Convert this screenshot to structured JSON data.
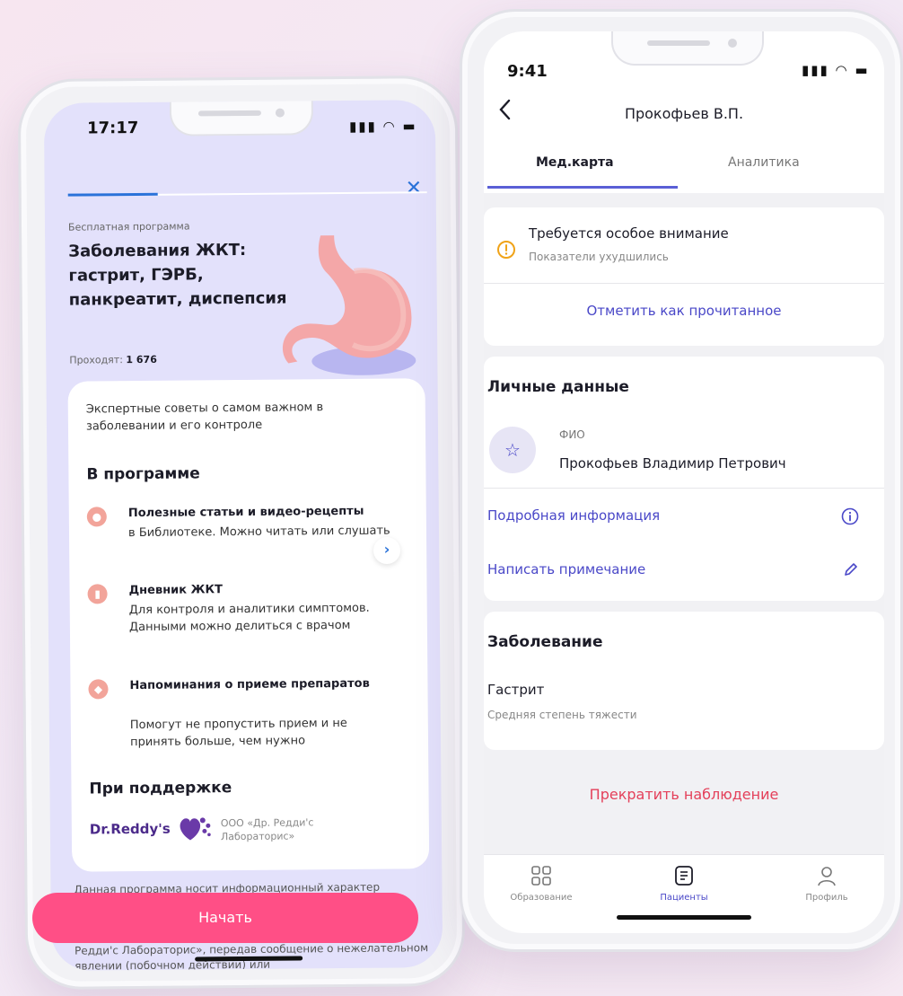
{
  "left_phone": {
    "status_time": "17:17",
    "program_type": "Бесплатная программа",
    "program_title": "Заболевания ЖКТ: гастрит, ГЭРБ, панкреатит, диспепсия",
    "participants_label": "Проходят:",
    "participants_count": "1 676",
    "progress": 0.25,
    "intro": "Экспертные советы о самом важном в заболевании и его контроле",
    "in_program_heading": "В программе",
    "features": [
      {
        "title": "Полезные статьи и видео-рецепты",
        "desc": "в Библиотеке. Можно читать или слушать",
        "icon": "article-icon"
      },
      {
        "title": "Дневник ЖКТ",
        "desc": "Для контроля и аналитики симптомов. Данными можно делиться с врачом",
        "icon": "diary-icon"
      },
      {
        "title": "Напоминания о приеме препаратов",
        "desc": "Помогут не пропустить прием и не принять больше, чем нужно",
        "icon": "pill-icon"
      }
    ],
    "support_heading": "При поддержке",
    "sponsor_logo_text": "Dr.Reddy's",
    "sponsor_name": "ООО «Др. Редди'с Лабораторис»",
    "disclaimer_top": "Данная программа носит информационный характер",
    "disclaimer_bottom": "Редди'с Лабораторис», передав сообщение о нежелательном явлении (побочном действии) или",
    "start_button": "Начать",
    "accent_color": "#ff4f86"
  },
  "right_phone": {
    "status_time": "9:41",
    "patient_title": "Прокофьев В.П.",
    "tabs": [
      {
        "label": "Мед.карта",
        "active": true
      },
      {
        "label": "Аналитика",
        "active": false
      }
    ],
    "alert_title": "Требуется особое внимание",
    "alert_subtitle": "Показатели ухудшились",
    "mark_read_button": "Отметить как прочитанное",
    "personal_heading": "Личные данные",
    "fio_label": "ФИО",
    "fio_value": "Прокофьев Владимир Петрович",
    "details_link": "Подробная информация",
    "note_link": "Написать примечание",
    "disease_heading": "Заболевание",
    "disease_name": "Гастрит",
    "disease_severity": "Средняя степень тяжести",
    "stop_button": "Прекратить наблюдение",
    "nav": [
      {
        "label": "Образование",
        "icon": "grid-icon",
        "active": false
      },
      {
        "label": "Пациенты",
        "icon": "document-icon",
        "active": true
      },
      {
        "label": "Профиль",
        "icon": "user-icon",
        "active": false
      }
    ]
  }
}
